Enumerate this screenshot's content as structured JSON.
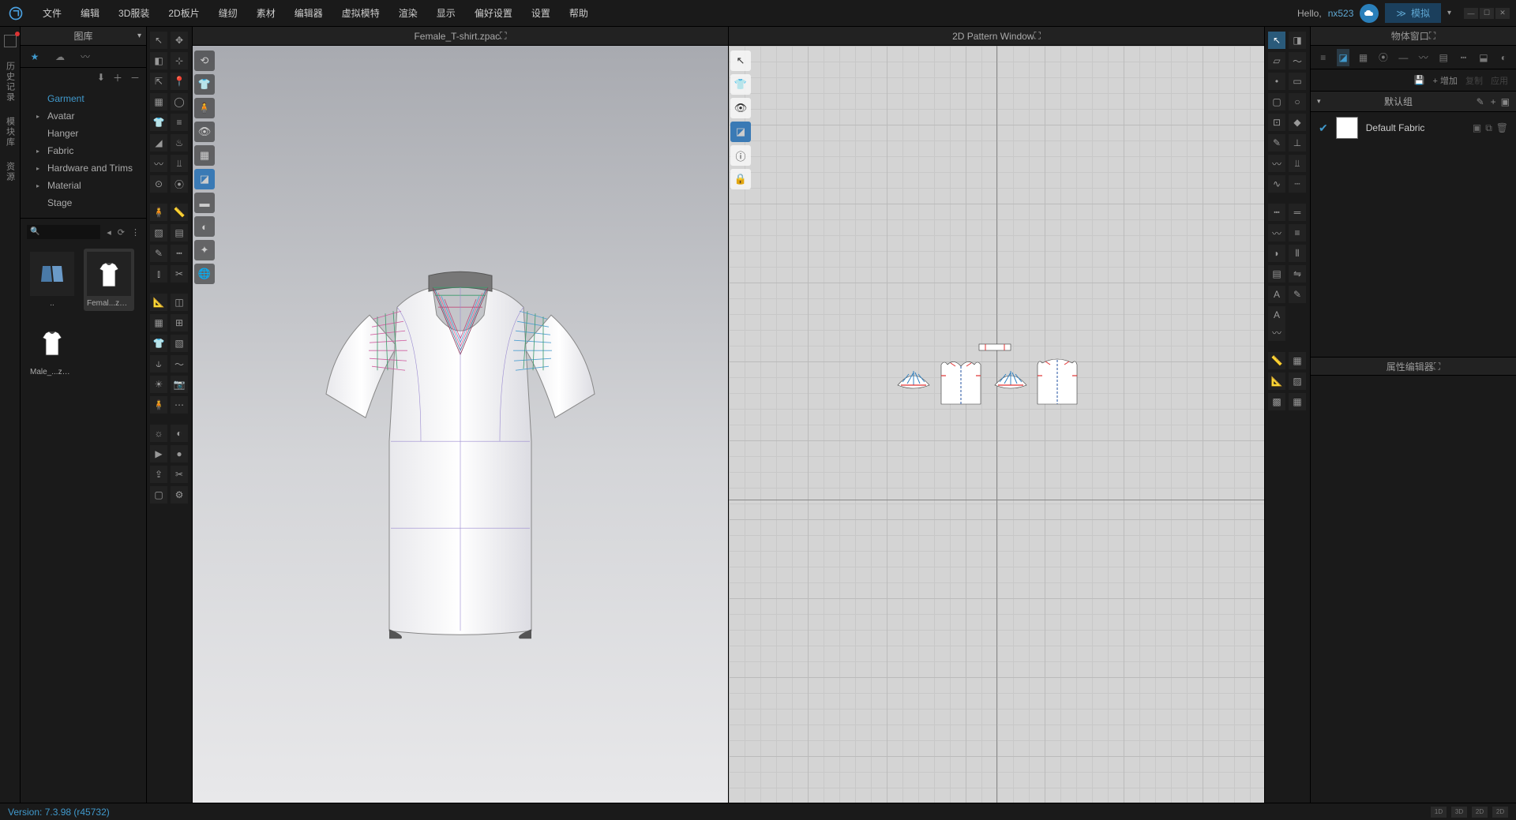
{
  "menu": {
    "items": [
      "文件",
      "编辑",
      "3D服装",
      "2D板片",
      "缝纫",
      "素材",
      "编辑器",
      "虚拟模特",
      "渲染",
      "显示",
      "偏好设置",
      "设置",
      "帮助"
    ],
    "hello": "Hello,",
    "username": "nx523",
    "simulate": "模拟"
  },
  "leftRail": {
    "items": [
      "历史记录",
      "模块库",
      "资源"
    ]
  },
  "library": {
    "title": "图库",
    "tree": [
      {
        "label": "Garment",
        "selected": true,
        "expandable": false
      },
      {
        "label": "Avatar",
        "expandable": true
      },
      {
        "label": "Hanger",
        "expandable": false
      },
      {
        "label": "Fabric",
        "expandable": true
      },
      {
        "label": "Hardware and Trims",
        "expandable": true
      },
      {
        "label": "Material",
        "expandable": true
      },
      {
        "label": "Stage",
        "expandable": false
      }
    ],
    "items": [
      {
        "label": "..",
        "type": "folder"
      },
      {
        "label": "Femal...zpac",
        "type": "garment-f",
        "selected": true
      },
      {
        "label": "Male_...zpac",
        "type": "garment-m"
      }
    ]
  },
  "viewport3d": {
    "title": "Female_T-shirt.zpac"
  },
  "viewport2d": {
    "title": "2D Pattern Window"
  },
  "objectPanel": {
    "title": "物体窗口",
    "add": "增加",
    "copy": "复制",
    "apply": "应用",
    "groupTitle": "默认组",
    "fabric": {
      "name": "Default Fabric"
    }
  },
  "propertyPanel": {
    "title": "属性编辑器"
  },
  "status": {
    "version": "Version: 7.3.98 (r45732)",
    "buttons": [
      "1D",
      "3D",
      "2D",
      "2D"
    ]
  },
  "icons": {
    "chart": "▦"
  }
}
